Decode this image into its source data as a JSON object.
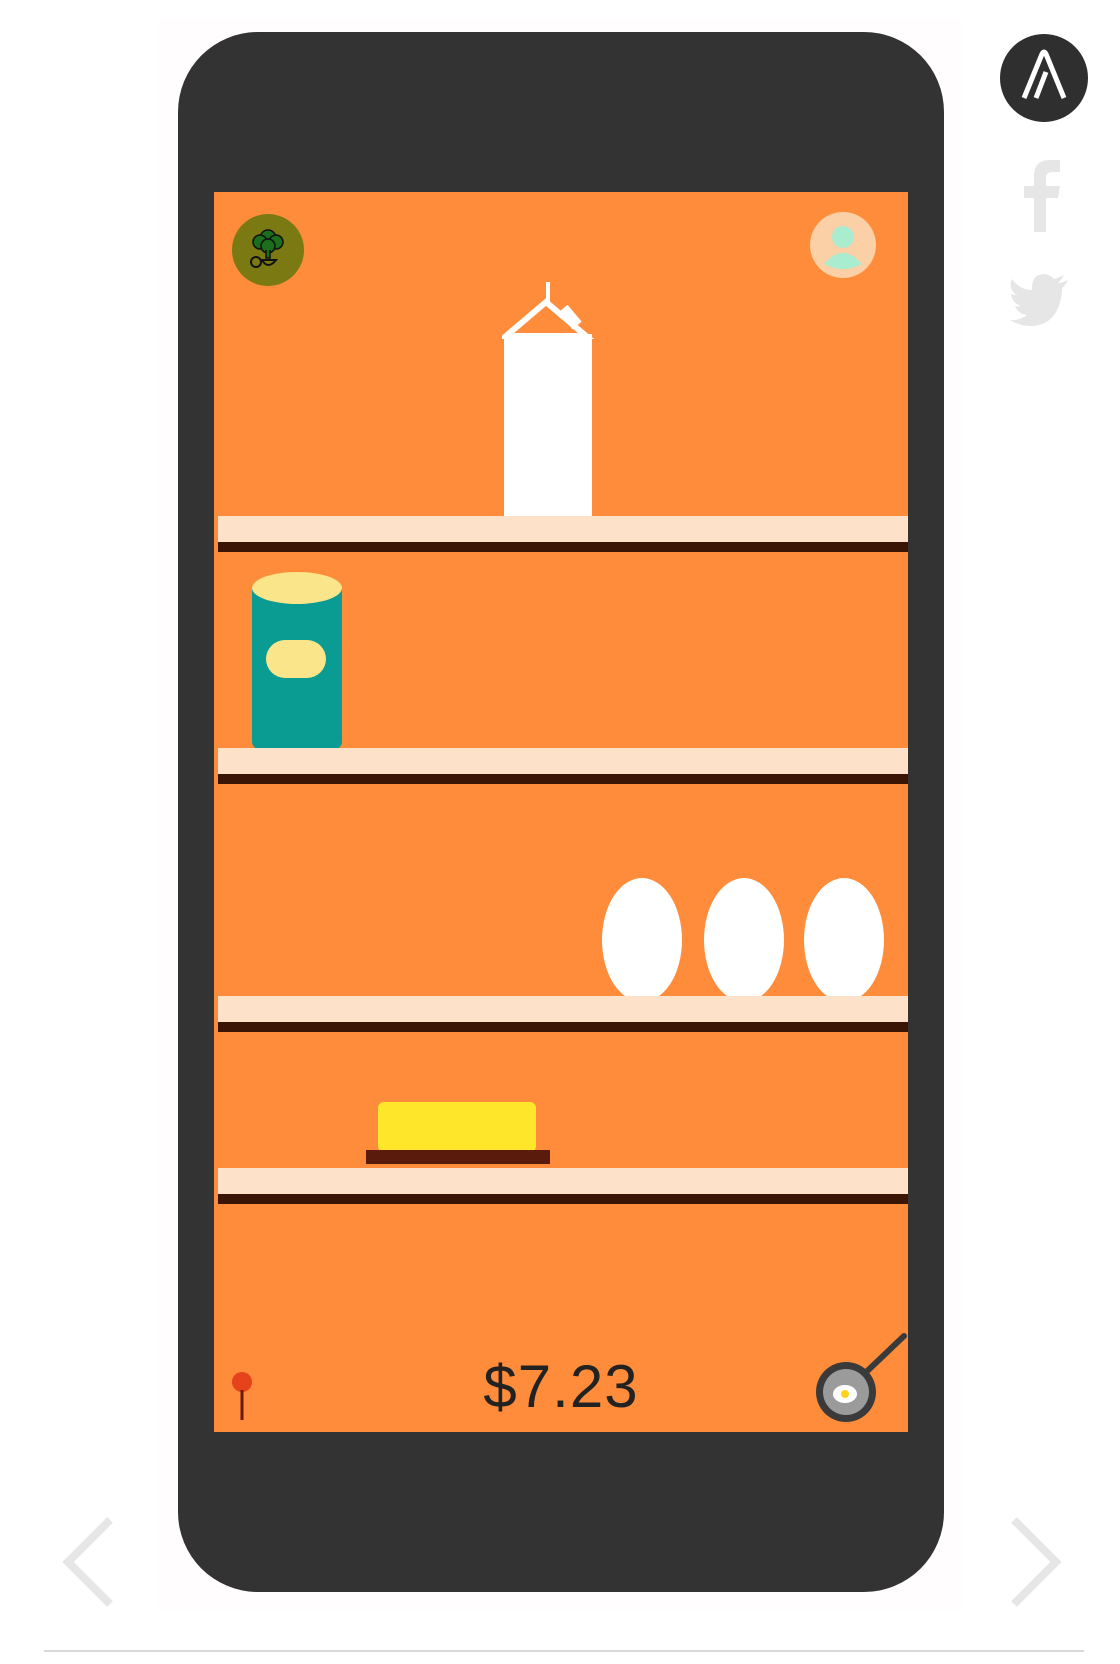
{
  "brand": {
    "logo_icon": "a-logo-icon",
    "logo_bg": "#2f2f2f"
  },
  "social": {
    "facebook_icon": "facebook-icon",
    "twitter_icon": "twitter-icon",
    "color": "#e6e6e6"
  },
  "app": {
    "left_button_icon": "broccoli-icon",
    "right_button_icon": "user-avatar-icon",
    "price": "$7.23",
    "bottom_left_icon": "pin-icon",
    "bottom_right_icon": "frying-pan-egg-icon",
    "colors": {
      "screen_bg": "#fe8c3a",
      "shelf": "#fde1c8",
      "shelf_shadow": "#3a1506",
      "phone": "#333333"
    },
    "shelf_items": [
      {
        "name": "milk-carton"
      },
      {
        "name": "canned-food"
      },
      {
        "name": "eggs",
        "count": 3
      },
      {
        "name": "butter"
      }
    ]
  },
  "navigation": {
    "prev_icon": "chevron-left-icon",
    "next_icon": "chevron-right-icon"
  }
}
